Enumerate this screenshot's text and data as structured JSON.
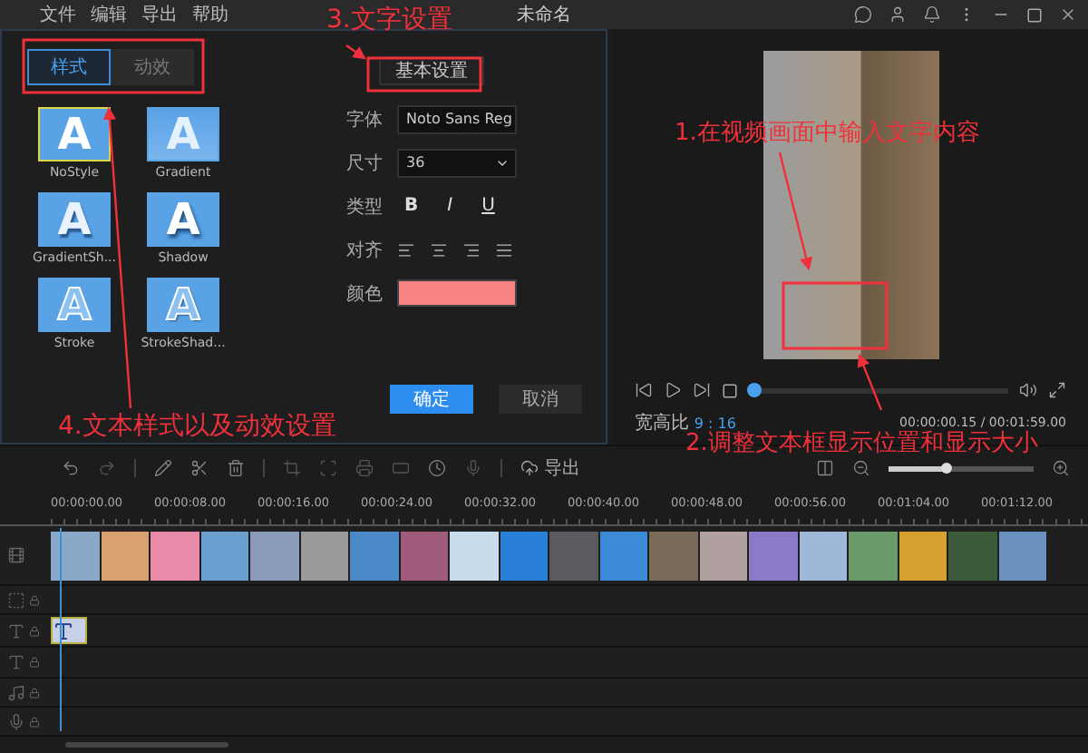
{
  "title_bar": {
    "menus": [
      "文件",
      "编辑",
      "导出",
      "帮助"
    ],
    "title": "未命名"
  },
  "style_panel": {
    "tabs": [
      {
        "label": "样式",
        "selected": true
      },
      {
        "label": "动效",
        "selected": false
      }
    ],
    "styles": [
      {
        "label": "NoStyle",
        "sample": "A",
        "kind": "plain",
        "selected": true
      },
      {
        "label": "Gradient",
        "sample": "A",
        "kind": "gradient",
        "selected": false
      },
      {
        "label": "GradientSh...",
        "sample": "A",
        "kind": "gradient-shadow",
        "selected": false
      },
      {
        "label": "Shadow",
        "sample": "A",
        "kind": "shadow",
        "selected": false
      },
      {
        "label": "Stroke",
        "sample": "A",
        "kind": "stroke",
        "selected": false
      },
      {
        "label": "StrokeShad...",
        "sample": "A",
        "kind": "stroke-shadow",
        "selected": false
      }
    ]
  },
  "settings": {
    "header": "基本设置",
    "rows": [
      {
        "kind": "select",
        "label": "字体",
        "value": "Noto Sans Reg"
      },
      {
        "kind": "select",
        "label": "尺寸",
        "value": "36"
      },
      {
        "kind": "format",
        "label": "类型",
        "buttons": [
          "B",
          "I",
          "U"
        ]
      },
      {
        "kind": "align",
        "label": "对齐"
      },
      {
        "kind": "color",
        "label": "颜色",
        "color": "#f98282"
      }
    ],
    "buttons": [
      {
        "label": "确定",
        "kind": "primary"
      },
      {
        "label": "取消",
        "kind": "secondary"
      }
    ]
  },
  "preview": {
    "progress": {
      "level": 0.02
    },
    "aspect_label": "宽高比",
    "aspect_value": "9 : 16",
    "time": "00:00:00.15 / 00:01:59.00"
  },
  "toolbar": {
    "export_label": "导出",
    "zoom": {
      "level": 0.4
    }
  },
  "timeline": {
    "ticks": [
      "00:00:00.00",
      "00:00:08.00",
      "00:00:16.00",
      "00:00:24.00",
      "00:00:32.00",
      "00:00:40.00",
      "00:00:48.00",
      "00:00:56.00",
      "00:01:04.00",
      "00:01:12.00"
    ]
  },
  "annotations": {
    "settings_note": "3.文字设置",
    "video_note": "1.在视频画面中输入文字内容",
    "style_note": "4.文本样式以及动效设置",
    "textbox_note": "2.调整文本框显示位置和显示大小"
  }
}
